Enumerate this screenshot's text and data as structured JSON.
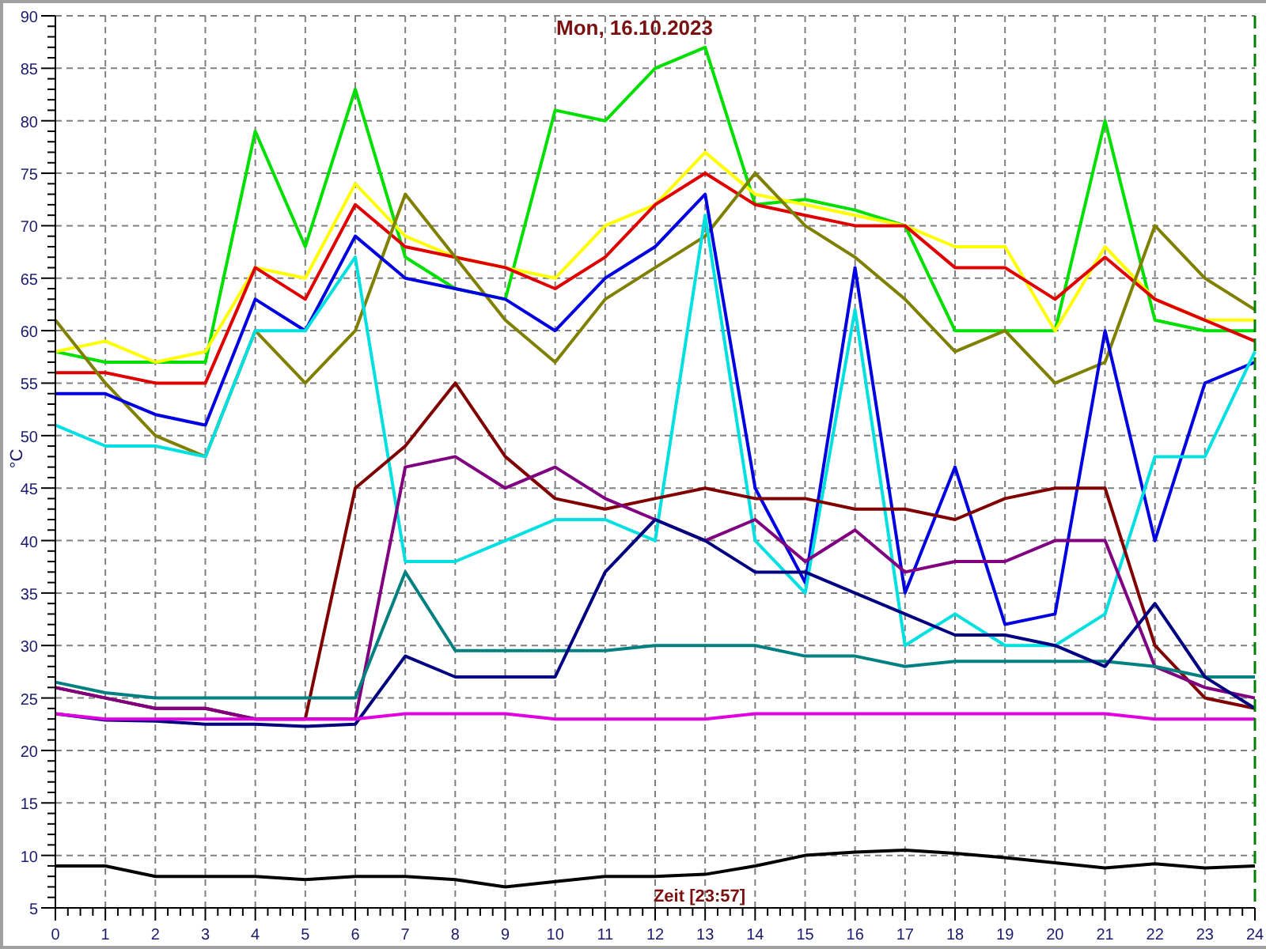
{
  "chart": {
    "chart_data": {
      "type": "line",
      "title": "Mon, 16.10.2023",
      "xlabel": "Zeit [23:57]",
      "ylabel": "°C",
      "x": [
        0,
        1,
        2,
        3,
        4,
        5,
        6,
        7,
        8,
        9,
        10,
        11,
        12,
        13,
        14,
        15,
        16,
        17,
        18,
        19,
        20,
        21,
        22,
        23,
        24
      ],
      "grid": true,
      "xlim": [
        0,
        24
      ],
      "ylim": [
        5,
        90
      ],
      "xticks": [
        0,
        1,
        2,
        3,
        4,
        5,
        6,
        7,
        8,
        9,
        10,
        11,
        12,
        13,
        14,
        15,
        16,
        17,
        18,
        19,
        20,
        21,
        22,
        23,
        24
      ],
      "yticks": [
        5,
        10,
        15,
        20,
        25,
        30,
        35,
        40,
        45,
        50,
        55,
        60,
        65,
        70,
        75,
        80,
        85,
        90
      ],
      "series": [
        {
          "color": "#00e000",
          "values": [
            58,
            57,
            57,
            57,
            79,
            68,
            83,
            67,
            64,
            63,
            81,
            80,
            85,
            87,
            72,
            72.5,
            71.5,
            70,
            60,
            60,
            60,
            80,
            61,
            60,
            60
          ]
        },
        {
          "color": "#ffff00",
          "values": [
            58,
            59,
            57,
            58,
            66,
            65,
            74,
            69,
            67,
            66,
            65,
            70,
            72,
            77,
            73,
            72,
            71,
            70,
            68,
            68,
            60,
            68,
            63,
            61,
            61
          ]
        },
        {
          "color": "#e00000",
          "values": [
            56,
            56,
            55,
            55,
            66,
            63,
            72,
            68,
            67,
            66,
            64,
            67,
            72,
            75,
            72,
            71,
            70,
            70,
            66,
            66,
            63,
            67,
            63,
            61,
            59
          ]
        },
        {
          "color": "#808000",
          "values": [
            61,
            55,
            50,
            48,
            60,
            55,
            60,
            73,
            67,
            61,
            57,
            63,
            66,
            69,
            75,
            70,
            67,
            63,
            58,
            60,
            55,
            57,
            70,
            65,
            62
          ]
        },
        {
          "color": "#0000e0",
          "values": [
            54,
            54,
            52,
            51,
            63,
            60,
            69,
            65,
            64,
            63,
            60,
            65,
            68,
            73,
            45,
            36,
            66,
            35,
            47,
            32,
            33,
            60,
            40,
            55,
            57
          ]
        },
        {
          "color": "#00e0e0",
          "values": [
            51,
            49,
            49,
            48,
            60,
            60,
            67,
            38,
            38,
            40,
            42,
            42,
            40,
            71,
            40,
            35,
            62,
            30,
            33,
            30,
            30,
            33,
            48,
            48,
            58
          ]
        },
        {
          "color": "#800000",
          "values": [
            26,
            25,
            24,
            24,
            23,
            23,
            45,
            49,
            55,
            48,
            44,
            43,
            44,
            45,
            44,
            44,
            43,
            43,
            42,
            44,
            45,
            45,
            30,
            25,
            24
          ]
        },
        {
          "color": "#800080",
          "values": [
            26,
            25,
            24,
            24,
            23,
            23,
            23,
            47,
            48,
            45,
            47,
            44,
            42,
            40,
            42,
            38,
            41,
            37,
            38,
            38,
            40,
            40,
            28,
            26,
            25
          ]
        },
        {
          "color": "#008080",
          "values": [
            26.5,
            25.5,
            25,
            25,
            25,
            25,
            25,
            37,
            29.5,
            29.5,
            29.5,
            29.5,
            30,
            30,
            30,
            29,
            29,
            28,
            28.5,
            28.5,
            28.5,
            28.5,
            28,
            27,
            27
          ]
        },
        {
          "color": "#000080",
          "values": [
            23.5,
            22.9,
            22.8,
            22.5,
            22.5,
            22.3,
            22.5,
            29,
            27,
            27,
            27,
            37,
            42,
            40,
            37,
            37,
            35,
            33,
            31,
            31,
            30,
            28,
            34,
            27,
            24
          ]
        },
        {
          "color": "#e000e0",
          "values": [
            23.5,
            23,
            23,
            23,
            23,
            23,
            23,
            23.5,
            23.5,
            23.5,
            23,
            23,
            23,
            23,
            23.5,
            23.5,
            23.5,
            23.5,
            23.5,
            23.5,
            23.5,
            23.5,
            23,
            23,
            23
          ]
        },
        {
          "color": "#000000",
          "values": [
            9,
            9,
            8,
            8,
            8,
            7.7,
            8,
            8,
            7.7,
            7,
            7.5,
            8,
            8,
            8.2,
            9,
            10,
            10.3,
            10.5,
            10.2,
            9.8,
            9.3,
            8.8,
            9.2,
            8.8,
            9
          ]
        }
      ]
    }
  }
}
